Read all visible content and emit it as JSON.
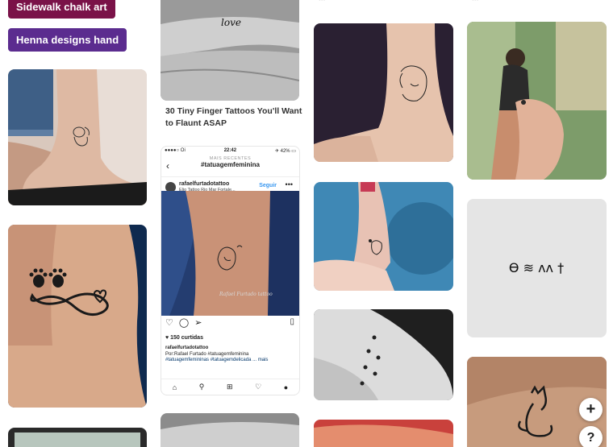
{
  "chips": [
    {
      "label": "Sidewalk chalk art",
      "color": "#7a1248"
    },
    {
      "label": "Henna designs hand",
      "color": "#5b2c8f"
    }
  ],
  "pins": {
    "finger_love_text": "love",
    "finger_caption": "30 Tiny Finger Tattoos You'll Want to Flaunt ASAP",
    "symbols_text": "ϴ ≋ ʌʌ †"
  },
  "instagram": {
    "carrier": "●●●●○ Oi",
    "time": "22:42",
    "battery": "✈ 42% ▭",
    "header_small": "MAIS RECENTES",
    "header_tag": "#tatuagemfeminina",
    "username": "rafaelfurtadotattoo",
    "location": "Elio Tattoo Rio Mar Fortale...",
    "follow": "Seguir",
    "more": "•••",
    "watermark": "Rafael Furtado tattoo",
    "likes": "♥ 150 curtidas",
    "caption_user": "rafaelfurtadotattoo",
    "caption_line2": "Por:Rafael Furtado  #tatuagemfeminina",
    "caption_line3": "#tatuagemfemininas #tatuagemdelicada ... mais"
  },
  "buttons": {
    "plus": "+",
    "help": "?"
  }
}
